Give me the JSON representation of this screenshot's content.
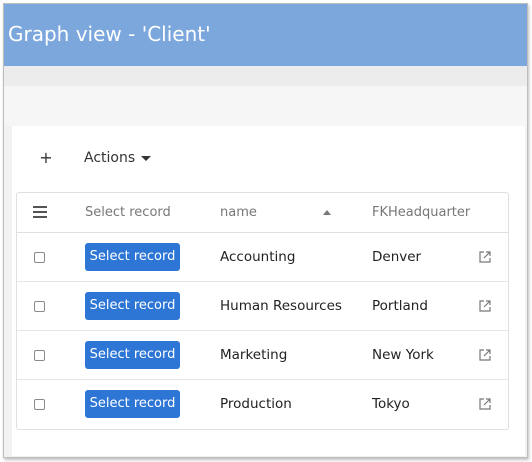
{
  "window": {
    "title": "Graph view - 'Client'"
  },
  "toolbar": {
    "add_label": "+",
    "actions_label": "Actions"
  },
  "grid": {
    "columns": {
      "select": "Select record",
      "name": "name",
      "headquarter": "FKHeadquarter"
    },
    "rows": [
      {
        "select_label": "Select record",
        "name": "Accounting",
        "headquarter": "Denver"
      },
      {
        "select_label": "Select record",
        "name": "Human Resources",
        "headquarter": "Portland"
      },
      {
        "select_label": "Select record",
        "name": "Marketing",
        "headquarter": "New York"
      },
      {
        "select_label": "Select record",
        "name": "Production",
        "headquarter": "Tokyo"
      }
    ]
  },
  "icons": {
    "column-menu": "menu-icon",
    "sort": "sort-asc-icon",
    "open": "external-link-icon",
    "actions": "chevron-down-icon"
  },
  "colors": {
    "titlebar": "#7ba7dc",
    "primary_button": "#2d76d6"
  }
}
